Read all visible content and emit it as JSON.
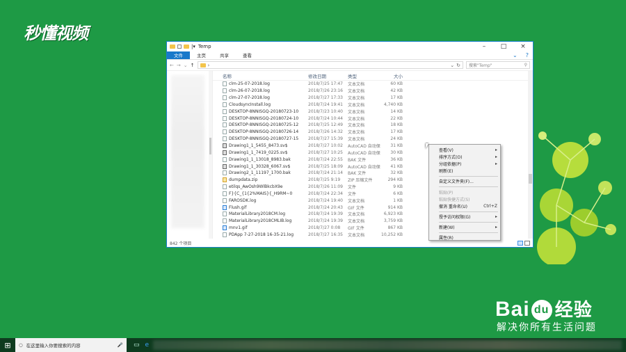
{
  "branding": {
    "top_logo": "秒懂视频",
    "baidu_logo_a": "Bai",
    "baidu_logo_b": "du",
    "baidu_logo_cn": "经验",
    "baidu_slogan": "解决你所有生活问题"
  },
  "window": {
    "title": "Temp",
    "qat_chevron": "|▾",
    "ribbon_tabs": [
      "文件",
      "主页",
      "共享",
      "查看"
    ],
    "path_chevron": "›",
    "search_placeholder": "搜索\"Temp\"",
    "columns": {
      "name": "名称",
      "date": "修改日期",
      "type": "类型",
      "size": "大小"
    },
    "status_text": "842 个项目"
  },
  "files": [
    {
      "name": "clm-25-07-2018.log",
      "date": "2018/7/25 17:47",
      "type": "文本文档",
      "size": "60 KB",
      "kind": "txt"
    },
    {
      "name": "clm-26-07-2018.log",
      "date": "2018/7/26 23:16",
      "type": "文本文档",
      "size": "42 KB",
      "kind": "txt"
    },
    {
      "name": "clm-27-07-2018.log",
      "date": "2018/7/27 17:33",
      "type": "文本文档",
      "size": "17 KB",
      "kind": "txt"
    },
    {
      "name": "CloudsyncInstall.log",
      "date": "2018/7/24 19:41",
      "type": "文本文档",
      "size": "4,740 KB",
      "kind": "txt"
    },
    {
      "name": "DESKTOP-8NNISGQ-20180723-1036.l",
      "date": "2018/7/23 10:40",
      "type": "文本文档",
      "size": "14 KB",
      "kind": "txt"
    },
    {
      "name": "DESKTOP-8NNISGQ-20180724-1042.l",
      "date": "2018/7/24 10:44",
      "type": "文本文档",
      "size": "22 KB",
      "kind": "txt"
    },
    {
      "name": "DESKTOP-8NNISGQ-20180725-1249.l",
      "date": "2018/7/25 12:49",
      "type": "文本文档",
      "size": "18 KB",
      "kind": "txt"
    },
    {
      "name": "DESKTOP-8NNISGQ-20180726-1432.l",
      "date": "2018/7/26 14:32",
      "type": "文本文档",
      "size": "17 KB",
      "kind": "txt"
    },
    {
      "name": "DESKTOP-8NNISGQ-20180727-1538.l",
      "date": "2018/7/27 15:39",
      "type": "文本文档",
      "size": "24 KB",
      "kind": "txt"
    },
    {
      "name": "Drawing1_1_5455_8473.sv$",
      "date": "2018/7/27 10:02",
      "type": "AutoCAD 自动保",
      "size": "31 KB",
      "kind": "dwg"
    },
    {
      "name": "Drawing1_1_7419_0225.sv$",
      "date": "2018/7/27 10:25",
      "type": "AutoCAD 自动保",
      "size": "30 KB",
      "kind": "dwg"
    },
    {
      "name": "Drawing1_1_13018_8983.bak",
      "date": "2018/7/24 22:55",
      "type": "BAK 文件",
      "size": "36 KB",
      "kind": "txt"
    },
    {
      "name": "Drawing1_1_30328_6067.sv$",
      "date": "2018/7/25 18:09",
      "type": "AutoCAD 自动保",
      "size": "41 KB",
      "kind": "dwg"
    },
    {
      "name": "Drawing2_1_11197_1700.bak",
      "date": "2018/7/24 21:14",
      "type": "BAK 文件",
      "size": "32 KB",
      "kind": "txt"
    },
    {
      "name": "dumpdata.zip",
      "date": "2018/7/25 9:19",
      "type": "ZIP 压缩文件",
      "size": "294 KB",
      "kind": "zip"
    },
    {
      "name": "etilqs_AwOsh9WlBkcbX9e",
      "date": "2018/7/26 11:09",
      "type": "文件",
      "size": "9 KB",
      "kind": "txt"
    },
    {
      "name": "F}{C_{1{2%MAIS}{_H9RM~0",
      "date": "2018/7/24 22:34",
      "type": "文件",
      "size": "6 KB",
      "kind": "txt"
    },
    {
      "name": "FAROSDK.log",
      "date": "2018/7/24 19:40",
      "type": "文本文档",
      "size": "1 KB",
      "kind": "txt"
    },
    {
      "name": "Flush.gif",
      "date": "2018/7/24 20:43",
      "type": "GIF 文件",
      "size": "914 KB",
      "kind": "gif"
    },
    {
      "name": "MaterialLibrary2018CM.log",
      "date": "2018/7/24 19:39",
      "type": "文本文档",
      "size": "6,923 KB",
      "kind": "txt"
    },
    {
      "name": "MaterialLibrary2018CMLIB.log",
      "date": "2018/7/24 19:39",
      "type": "文本文档",
      "size": "3,759 KB",
      "kind": "txt"
    },
    {
      "name": "mnv1.gif",
      "date": "2018/7/27 0:08",
      "type": "GIF 文件",
      "size": "867 KB",
      "kind": "gif"
    },
    {
      "name": "PDApp 7-27-2018 16-35-21.log",
      "date": "2018/7/27 16:35",
      "type": "文本文档",
      "size": "10,252 KB",
      "kind": "txt"
    }
  ],
  "context_menu": {
    "items": [
      {
        "label": "查看(V)",
        "submenu": true,
        "disabled": false
      },
      {
        "label": "排序方式(O)",
        "submenu": true,
        "disabled": false
      },
      {
        "label": "分组依据(P)",
        "submenu": true,
        "disabled": false
      },
      {
        "label": "刷新(E)",
        "submenu": false,
        "disabled": false
      },
      {
        "sep": true
      },
      {
        "label": "自定义文件夹(F)...",
        "submenu": false,
        "disabled": false
      },
      {
        "sep": true
      },
      {
        "label": "粘贴(P)",
        "submenu": false,
        "disabled": true
      },
      {
        "label": "粘贴快捷方式(S)",
        "submenu": false,
        "disabled": true
      },
      {
        "label": "撤消 重命名(U)",
        "submenu": false,
        "disabled": false,
        "shortcut": "Ctrl+Z"
      },
      {
        "sep": true
      },
      {
        "label": "授予访问权限(G)",
        "submenu": true,
        "disabled": false
      },
      {
        "sep": true
      },
      {
        "label": "新建(W)",
        "submenu": true,
        "disabled": false
      },
      {
        "sep": true
      },
      {
        "label": "属性(R)",
        "submenu": false,
        "disabled": false
      }
    ]
  },
  "taskbar": {
    "search_placeholder": "在这里输入你要搜索的内容"
  },
  "colors": {
    "desktop": "#1e9a45",
    "accent": "#1979ca",
    "taskbar": "#0e3b1f"
  }
}
